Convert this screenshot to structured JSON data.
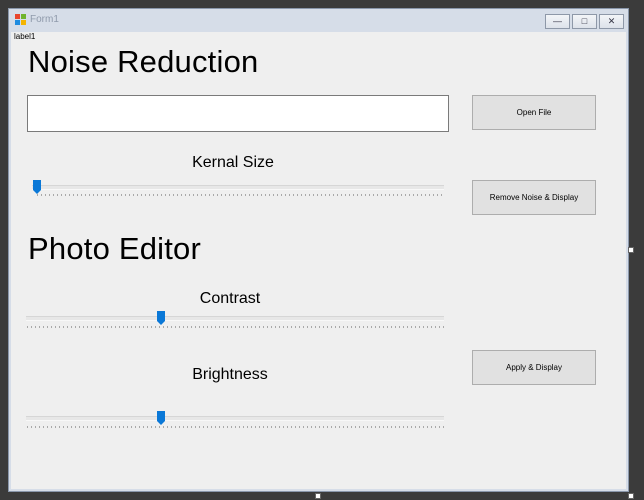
{
  "window": {
    "title": "Form1",
    "controls": {
      "minimize": "—",
      "maximize": "□",
      "close": "✕"
    }
  },
  "form": {
    "label1": "label1",
    "noise_section": {
      "heading": "Noise Reduction",
      "file_path_value": "",
      "open_file_label": "Open File",
      "kernel_caption": "Kernal Size",
      "kernel_slider_fraction": 0.0,
      "remove_noise_label": "Remove Noise & Display"
    },
    "photo_section": {
      "heading": "Photo Editor",
      "contrast_caption": "Contrast",
      "contrast_slider_fraction": 0.32,
      "brightness_caption": "Brightness",
      "brightness_slider_fraction": 0.32,
      "apply_label": "Apply & Display"
    }
  },
  "colors": {
    "accent": "#0a78d7",
    "button_face": "#e1e1e1",
    "form_background": "#efefef"
  }
}
